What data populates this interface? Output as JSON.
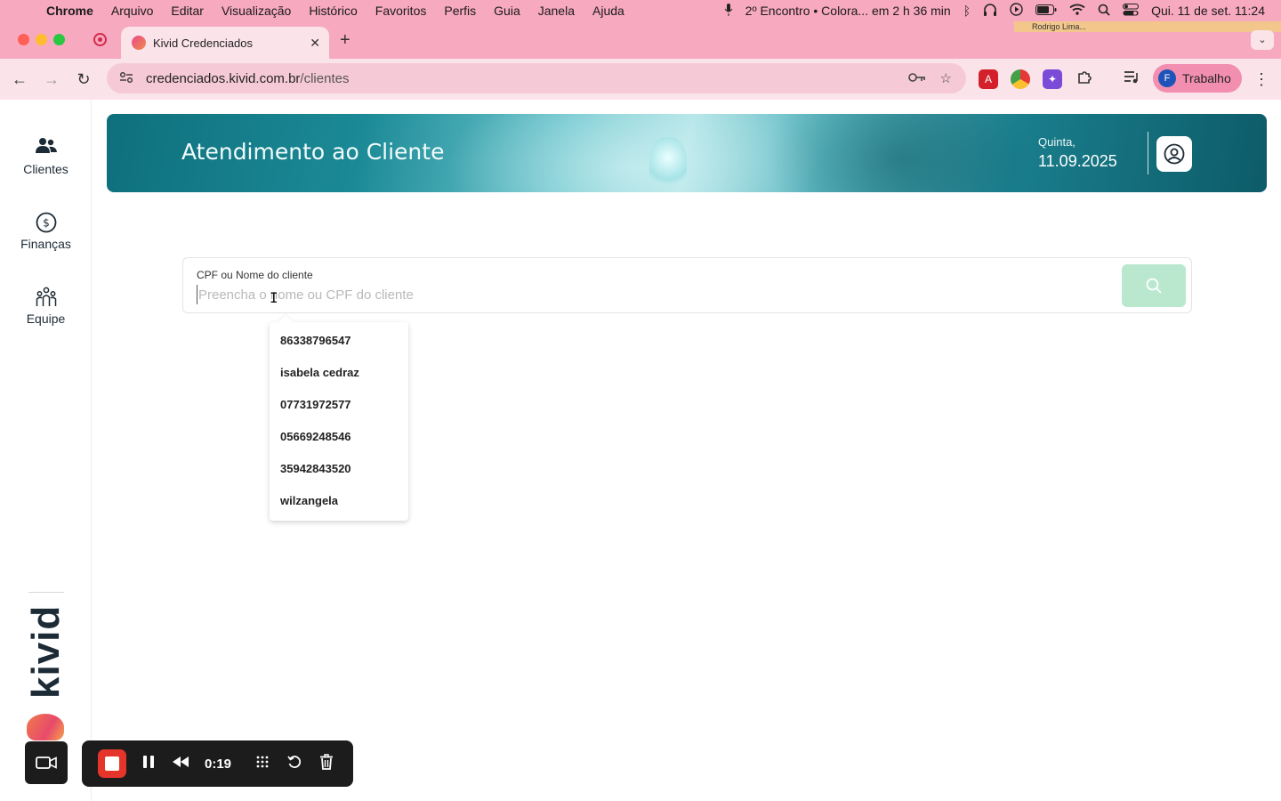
{
  "menubar": {
    "app_name": "Chrome",
    "items": [
      "Arquivo",
      "Editar",
      "Visualização",
      "Histórico",
      "Favoritos",
      "Perfis",
      "Guia",
      "Janela",
      "Ajuda"
    ],
    "event_text": "2º Encontro • Colora... em 2 h 36 min",
    "clock": "Qui. 11 de set.  11:24"
  },
  "browser": {
    "tab_title": "Kivid Credenciados",
    "profile_tag": "Rodrigo Lima...",
    "url_domain": "credenciados.kivid.com.br",
    "url_path": "/clientes",
    "profile_initial": "F",
    "profile_label": "Trabalho"
  },
  "sidebar": {
    "items": [
      {
        "label": "Clientes",
        "icon": "users-icon"
      },
      {
        "label": "Finanças",
        "icon": "dollar-circle-icon"
      },
      {
        "label": "Equipe",
        "icon": "team-icon"
      }
    ],
    "logo_text": "kivid"
  },
  "banner": {
    "title": "Atendimento ao Cliente",
    "day": "Quinta,",
    "date": "11.09.2025"
  },
  "search": {
    "label": "CPF ou Nome do cliente",
    "placeholder": "Preencha o nome ou CPF do cliente",
    "value": "",
    "button_color": "#b9e8cf",
    "suggestions": [
      "86338796547",
      "isabela cedraz",
      "07731972577",
      "05669248546",
      "35942843520",
      "wilzangela"
    ]
  },
  "recorder": {
    "elapsed": "0:19",
    "stop_color": "#e5352b"
  },
  "colors": {
    "chrome_theme": "#f7a9c0",
    "banner_teal": "#0f6f7c",
    "sidebar_text": "#1d2b36"
  }
}
